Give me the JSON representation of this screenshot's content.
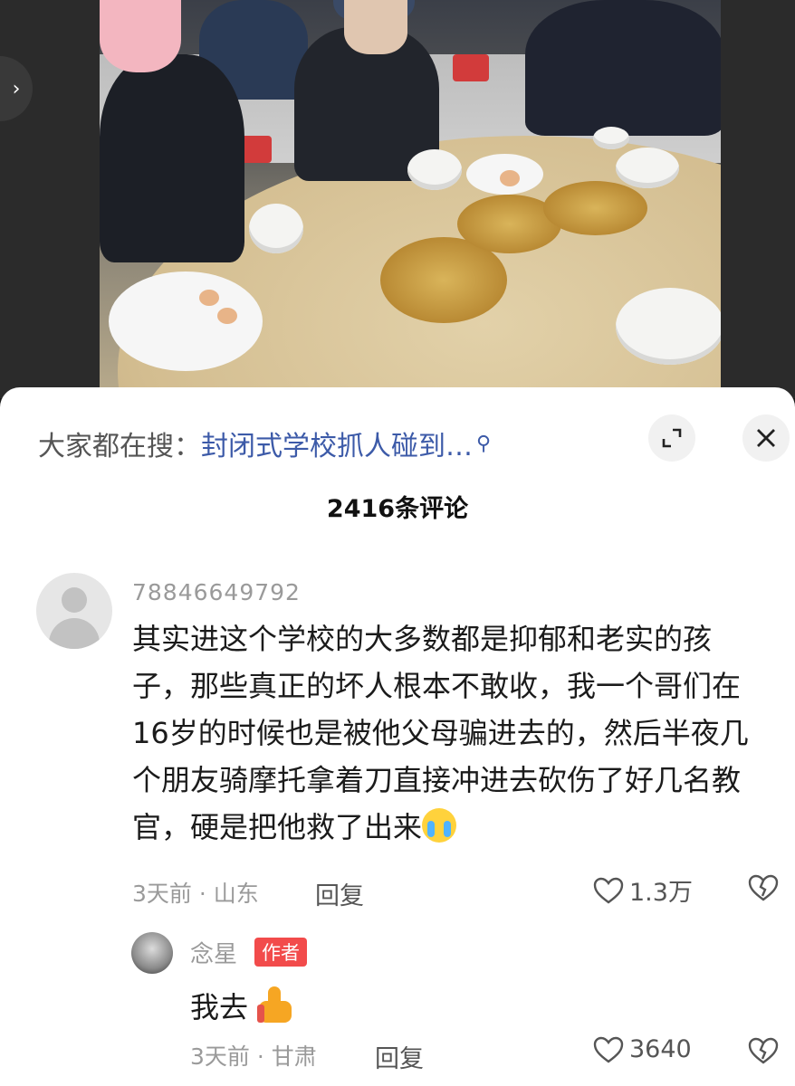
{
  "search_bar": {
    "prefix": "大家都在搜：",
    "query": "封闭式学校抓人碰到…",
    "search_icon": "search-icon"
  },
  "header": {
    "comment_count_title": "2416条评论",
    "expand_icon": "expand-icon",
    "close_icon": "close-icon"
  },
  "comments": [
    {
      "username": "78846649792",
      "text": "其实进这个学校的大多数都是抑郁和老实的孩子，那些真正的坏人根本不敢收，我一个哥们在16岁的时候也是被他父母骗进去的，然后半夜几个朋友骑摩托拿着刀直接冲进去砍伤了好几名教官，硬是把他救了出来",
      "emoji": "crying-laughing-emoji",
      "time_location": "3天前 · 山东",
      "reply_label": "回复",
      "like_count": "1.3万",
      "replies": [
        {
          "username": "念星",
          "badge": "作者",
          "text": "我去",
          "emoji": "thumbs-up-emoji",
          "time_location": "3天前 · 甘肃",
          "reply_label": "回复",
          "like_count": "3640"
        }
      ]
    }
  ],
  "colors": {
    "link_blue": "#3c5aa8",
    "author_badge_red": "#f24b4b",
    "secondary_text": "#9a9a9a"
  }
}
